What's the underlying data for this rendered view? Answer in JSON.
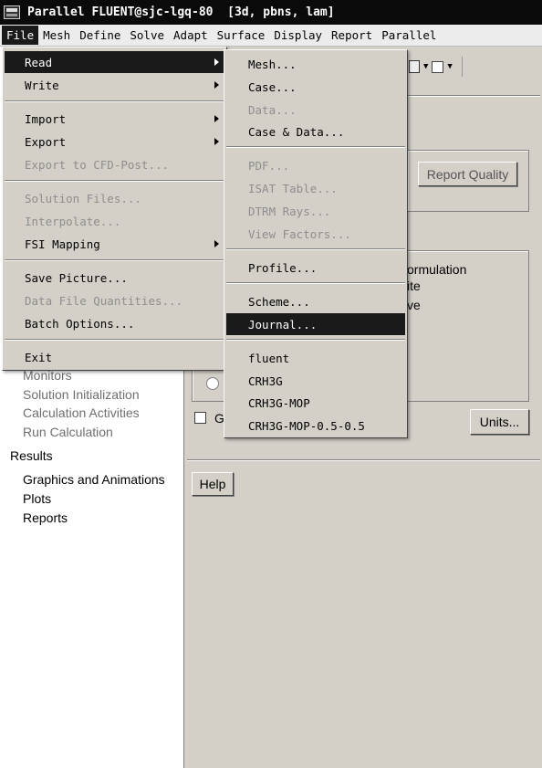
{
  "window": {
    "title": "Parallel FLUENT@sjc-lgq-80  [3d, pbns, lam]"
  },
  "menubar": {
    "items": [
      "File",
      "Mesh",
      "Define",
      "Solve",
      "Adapt",
      "Surface",
      "Display",
      "Report",
      "Parallel"
    ]
  },
  "tree": {
    "muted_items": [
      "Monitors",
      "Solution Initialization",
      "Calculation Activities",
      "Run Calculation"
    ],
    "results_label": "Results",
    "results_items": [
      "Graphics and Animations",
      "Plots",
      "Reports"
    ]
  },
  "panel": {
    "report_quality_label": "Report Quality",
    "formulation_label": "ormulation",
    "ite_label": "ite",
    "ve_label": "ve",
    "g_label": "G",
    "units_label": "Units...",
    "help_label": "Help"
  },
  "file_menu": {
    "items": [
      {
        "label": "Read",
        "submenu": true,
        "enabled": true,
        "highlighted": true
      },
      {
        "label": "Write",
        "submenu": true,
        "enabled": true
      },
      {
        "label": "Import",
        "submenu": true,
        "enabled": true
      },
      {
        "label": "Export",
        "submenu": true,
        "enabled": true
      },
      {
        "label": "Export to CFD-Post...",
        "submenu": false,
        "enabled": false
      },
      {
        "label": "Solution Files...",
        "submenu": false,
        "enabled": false
      },
      {
        "label": "Interpolate...",
        "submenu": false,
        "enabled": false
      },
      {
        "label": "FSI Mapping",
        "submenu": true,
        "enabled": true
      },
      {
        "label": "Save Picture...",
        "submenu": false,
        "enabled": true
      },
      {
        "label": "Data File Quantities...",
        "submenu": false,
        "enabled": false
      },
      {
        "label": "Batch Options...",
        "submenu": false,
        "enabled": true
      },
      {
        "label": "Exit",
        "submenu": false,
        "enabled": true
      }
    ]
  },
  "read_menu": {
    "items": [
      {
        "label": "Mesh...",
        "enabled": true
      },
      {
        "label": "Case...",
        "enabled": true
      },
      {
        "label": "Data...",
        "enabled": false
      },
      {
        "label": "Case & Data...",
        "enabled": true
      },
      {
        "label": "PDF...",
        "enabled": false
      },
      {
        "label": "ISAT Table...",
        "enabled": false
      },
      {
        "label": "DTRM Rays...",
        "enabled": false
      },
      {
        "label": "View Factors...",
        "enabled": false
      },
      {
        "label": "Profile...",
        "enabled": true
      },
      {
        "label": "Scheme...",
        "enabled": true
      },
      {
        "label": "Journal...",
        "enabled": true,
        "highlighted": true
      },
      {
        "label": "fluent",
        "enabled": true
      },
      {
        "label": "CRH3G",
        "enabled": true
      },
      {
        "label": "CRH3G-MOP",
        "enabled": true
      },
      {
        "label": "CRH3G-MOP-0.5-0.5",
        "enabled": true
      }
    ]
  }
}
